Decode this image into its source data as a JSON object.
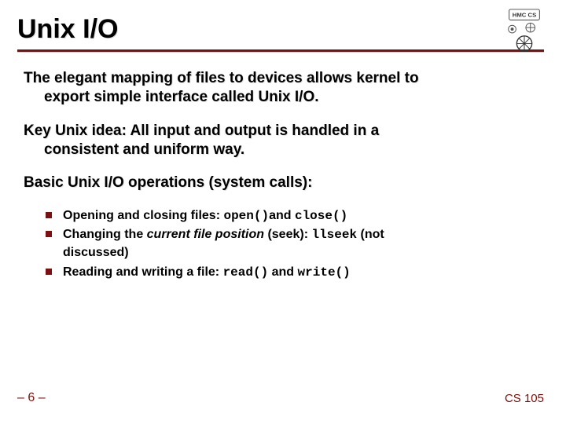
{
  "title": "Unix I/O",
  "para1_line1": "The elegant mapping of files to devices allows kernel to",
  "para1_line2": "export simple interface called Unix I/O.",
  "para2_line1": "Key Unix idea: All input and output is handled in a",
  "para2_line2": "consistent and uniform way.",
  "para3": "Basic Unix I/O operations (system calls):",
  "bullets": {
    "b1_pre": "Opening and closing files: ",
    "b1_code1": "open()",
    "b1_mid": "and ",
    "b1_code2": "close()",
    "b2_pre": "Changing the ",
    "b2_em": "current file position",
    "b2_mid": " (seek): ",
    "b2_code": "llseek",
    "b2_post": " (not",
    "b2_cont": "discussed)",
    "b3_pre": "Reading and writing a file: ",
    "b3_code1": "read()",
    "b3_mid": " and ",
    "b3_code2": "write()"
  },
  "footer_left": "– 6 –",
  "footer_right": "CS 105",
  "logo_label": "HMC CS"
}
